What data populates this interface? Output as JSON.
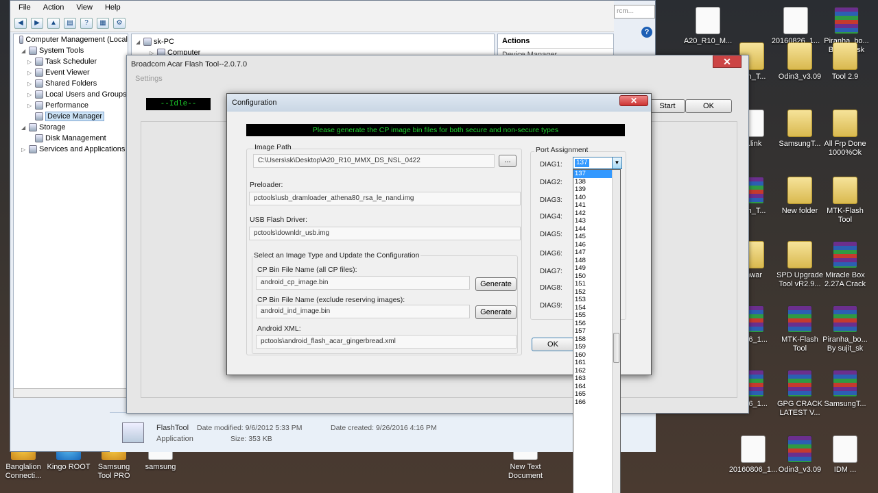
{
  "desktop_icons": [
    {
      "label": "A20_R10_M...",
      "glyph": "file"
    },
    {
      "label": "20160826_1...",
      "glyph": "file"
    },
    {
      "label": "Piranha_bo...\nBy sujit_sk",
      "glyph": "rar"
    },
    {
      "label": "lash_T...",
      "glyph": "folder"
    },
    {
      "label": "Odin3_v3.09",
      "glyph": "folder"
    },
    {
      "label": "Tool 2.9",
      "glyph": "folder"
    },
    {
      "label": "o..link",
      "glyph": "file"
    },
    {
      "label": "SamsungT...",
      "glyph": "folder"
    },
    {
      "label": "All Frp Done\n1000%Ok",
      "glyph": "folder"
    },
    {
      "label": "lash_T...",
      "glyph": "rar"
    },
    {
      "label": "New folder",
      "glyph": "folder"
    },
    {
      "label": "MTK-Flash\nTool",
      "glyph": "folder"
    },
    {
      "label": "anwar",
      "glyph": "folder"
    },
    {
      "label": "SPD Upgrade\nTool vR2.9...",
      "glyph": "folder"
    },
    {
      "label": "Miracle Box\n2.27A Crack",
      "glyph": "rar"
    },
    {
      "label": "0826_1...",
      "glyph": "rar"
    },
    {
      "label": "MTK-Flash\nTool",
      "glyph": "rar"
    },
    {
      "label": "Piranha_bo...\nBy sujit_sk",
      "glyph": "rar"
    },
    {
      "label": "0826_1...",
      "glyph": "rar"
    },
    {
      "label": "GPG CRACK\nLATEST V...",
      "glyph": "rar"
    },
    {
      "label": "SamsungT...",
      "glyph": "rar"
    },
    {
      "label": "20160806_1...",
      "glyph": "file"
    },
    {
      "label": "Odin3_v3.09",
      "glyph": "rar"
    },
    {
      "label": "IDM ...",
      "glyph": "file"
    },
    {
      "label": "Banglalion\nConnecti...",
      "glyph": "app"
    },
    {
      "label": "Kingo ROOT",
      "glyph": "kingo"
    },
    {
      "label": "Samsung\nTool PRO",
      "glyph": "app"
    },
    {
      "label": "samsung",
      "glyph": "file"
    },
    {
      "label": "New Text\nDocument",
      "glyph": "file"
    }
  ],
  "computer_management": {
    "menu": [
      "File",
      "Action",
      "View",
      "Help"
    ],
    "search_placeholder": "rcm...",
    "tree": [
      {
        "label": "Computer Management (Local",
        "indent": 0,
        "exp": ""
      },
      {
        "label": "System Tools",
        "indent": 1,
        "exp": "◢"
      },
      {
        "label": "Task Scheduler",
        "indent": 2,
        "exp": "▷"
      },
      {
        "label": "Event Viewer",
        "indent": 2,
        "exp": "▷"
      },
      {
        "label": "Shared Folders",
        "indent": 2,
        "exp": "▷"
      },
      {
        "label": "Local Users and Groups",
        "indent": 2,
        "exp": "▷"
      },
      {
        "label": "Performance",
        "indent": 2,
        "exp": "▷"
      },
      {
        "label": "Device Manager",
        "indent": 2,
        "exp": "",
        "selected": true
      },
      {
        "label": "Storage",
        "indent": 1,
        "exp": "◢"
      },
      {
        "label": "Disk Management",
        "indent": 2,
        "exp": ""
      },
      {
        "label": "Services and Applications",
        "indent": 1,
        "exp": "▷"
      }
    ],
    "middle": {
      "root": "sk-PC",
      "child": "Computer"
    },
    "actions_title": "Actions",
    "actions_item": "Device Manager"
  },
  "file_details": {
    "name": "FlashTool",
    "type": "Application",
    "date_modified": "Date modified: 9/6/2012 5:33 PM",
    "size": "Size: 353 KB",
    "date_created": "Date created: 9/26/2016 4:16 PM"
  },
  "flash_tool": {
    "title": "Broadcom Acar Flash Tool--2.0.7.0",
    "settings": "Settings",
    "status": "--Idle--",
    "start_label": "Start",
    "ok_label": "OK"
  },
  "config": {
    "title": "Configuration",
    "banner": "Please generate the CP image bin files for both secure and non-secure types",
    "image_path_label": "Image Path",
    "image_path": "C:\\Users\\sk\\Desktop\\A20_R10_MMX_DS_NSL_0422",
    "browse_label": "...",
    "preloader_label": "Preloader:",
    "preloader": "pctools\\usb_dramloader_athena80_rsa_le_nand.img",
    "usb_driver_label": "USB Flash Driver:",
    "usb_driver": "pctools\\downldr_usb.img",
    "select_group_label": "Select an Image Type and Update the Configuration",
    "cp_all_label": "CP Bin File Name (all CP files):",
    "cp_all": "android_cp_image.bin",
    "cp_excl_label": "CP Bin File Name (exclude reserving images):",
    "cp_excl": "android_ind_image.bin",
    "generate_label": "Generate",
    "xml_label": "Android XML:",
    "xml": "pctools\\android_flash_acar_gingerbread.xml",
    "port_label": "Port Assignment",
    "diags": [
      "DIAG1:",
      "DIAG2:",
      "DIAG3:",
      "DIAG4:",
      "DIAG5:",
      "DIAG6:",
      "DIAG7:",
      "DIAG8:",
      "DIAG9:"
    ],
    "diag1_value": "137",
    "ok_label": "OK",
    "dropdown_options": [
      "137",
      "138",
      "139",
      "140",
      "141",
      "142",
      "143",
      "144",
      "145",
      "146",
      "147",
      "148",
      "149",
      "150",
      "151",
      "152",
      "153",
      "154",
      "155",
      "156",
      "157",
      "158",
      "159",
      "160",
      "161",
      "162",
      "163",
      "164",
      "165",
      "166"
    ],
    "dropdown_selected": "137"
  }
}
